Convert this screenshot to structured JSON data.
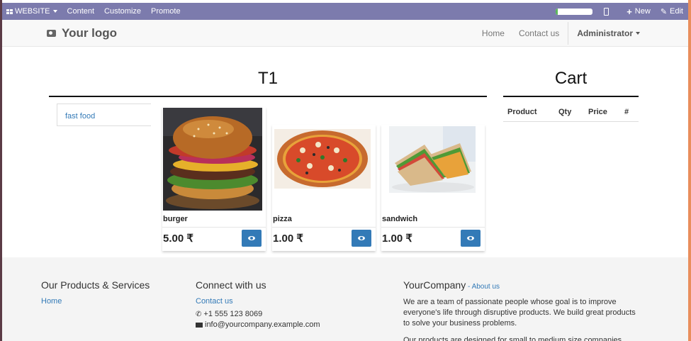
{
  "topbar": {
    "website_label": "WEBSITE",
    "content_label": "Content",
    "customize_label": "Customize",
    "promote_label": "Promote",
    "new_label": "New",
    "edit_label": "Edit",
    "progress_fraction": 0.05,
    "bg_color": "#7c7bad"
  },
  "navbar": {
    "logo_text": "Your logo",
    "home_label": "Home",
    "contact_label": "Contact us",
    "user_label": "Administrator"
  },
  "shop": {
    "title": "T1",
    "categories": [
      "fast food"
    ],
    "products": [
      {
        "name": "burger",
        "price": "5.00 ₹"
      },
      {
        "name": "pizza",
        "price": "1.00 ₹"
      },
      {
        "name": "sandwich",
        "price": "1.00 ₹"
      }
    ]
  },
  "cart": {
    "title": "Cart",
    "columns": [
      "Product",
      "Qty",
      "Price",
      "#"
    ]
  },
  "footer": {
    "products_heading": "Our Products & Services",
    "products_home": "Home",
    "connect_heading": "Connect with us",
    "connect_contact": "Contact us",
    "phone": "+1 555 123 8069",
    "email": "info@yourcompany.example.com",
    "company_name": "YourCompany",
    "company_about_sep": " - ",
    "company_about": "About us",
    "para1": "We are a team of passionate people whose goal is to improve everyone's life through disruptive products. We build great products to solve your business problems.",
    "para2": "Our products are designed for small to medium size companies willing"
  }
}
